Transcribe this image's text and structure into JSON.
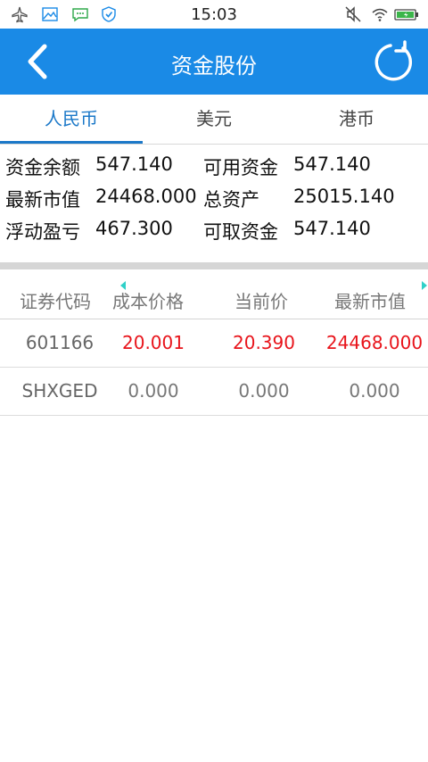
{
  "status_bar": {
    "time": "15:03",
    "left_icons": [
      "airplane-icon",
      "image-icon",
      "message-icon",
      "shield-check-icon"
    ],
    "right_icons": [
      "mute-icon",
      "wifi-icon",
      "battery-icon"
    ]
  },
  "app_bar": {
    "title": "资金股份",
    "background": "#1a8ae6"
  },
  "tabs": [
    {
      "label": "人民币",
      "active": true
    },
    {
      "label": "美元",
      "active": false
    },
    {
      "label": "港币",
      "active": false
    }
  ],
  "summary": {
    "rows": [
      {
        "left_label": "资金余额",
        "left_value": "547.140",
        "right_label": "可用资金",
        "right_value": "547.140"
      },
      {
        "left_label": "最新市值",
        "left_value": "24468.000",
        "right_label": "总资产",
        "right_value": "25015.140"
      },
      {
        "left_label": "浮动盈亏",
        "left_value": "467.300",
        "right_label": "可取资金",
        "right_value": "547.140"
      }
    ]
  },
  "table": {
    "headers": [
      "证券代码",
      "成本价格",
      "当前价",
      "最新市值"
    ],
    "rows": [
      {
        "code": "601166",
        "cost": "20.001",
        "price": "20.390",
        "value": "24468.000",
        "color": "#e8141b"
      },
      {
        "code": "SHXGED",
        "cost": "0.000",
        "price": "0.000",
        "value": "0.000",
        "color": "#777777"
      }
    ]
  }
}
